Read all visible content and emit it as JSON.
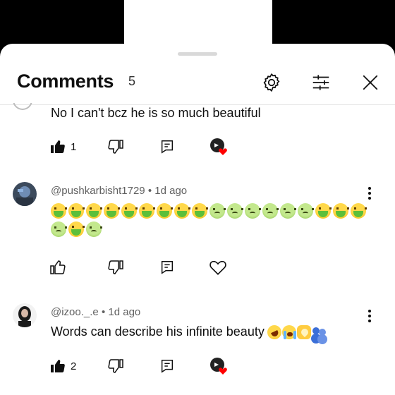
{
  "header": {
    "title": "Comments",
    "count": "5",
    "icons": [
      "settings-icon",
      "filter-icon",
      "close-icon"
    ]
  },
  "comments": [
    {
      "text": "No I can't bcz he is so much beautiful",
      "likes": "1",
      "creator_heart": true
    },
    {
      "author": "@pushkarbisht1729",
      "time": "1d ago",
      "emojis_line1": [
        "vomit",
        "vomit",
        "vomit",
        "vomit",
        "vomit",
        "vomit",
        "vomit",
        "vomit",
        "vomit",
        "nausea",
        "nausea",
        "nausea",
        "nausea",
        "nausea",
        "nausea",
        "vomit",
        "vomit",
        "vomit"
      ],
      "emojis_line2": [
        "nausea",
        "vomit",
        "nausea"
      ],
      "likes": "",
      "creator_heart": false
    },
    {
      "author": "@izoo._.e",
      "time": "1d ago",
      "text": "Words can describe his infinite beauty",
      "emojis": [
        "rofl",
        "cry",
        "heart-hands",
        "hug"
      ],
      "likes": "2",
      "creator_heart": true
    }
  ],
  "separator": "•",
  "colors": {
    "accent_heart": "#ff0000",
    "meta_text": "#606060",
    "divider": "#e5e5e5"
  }
}
